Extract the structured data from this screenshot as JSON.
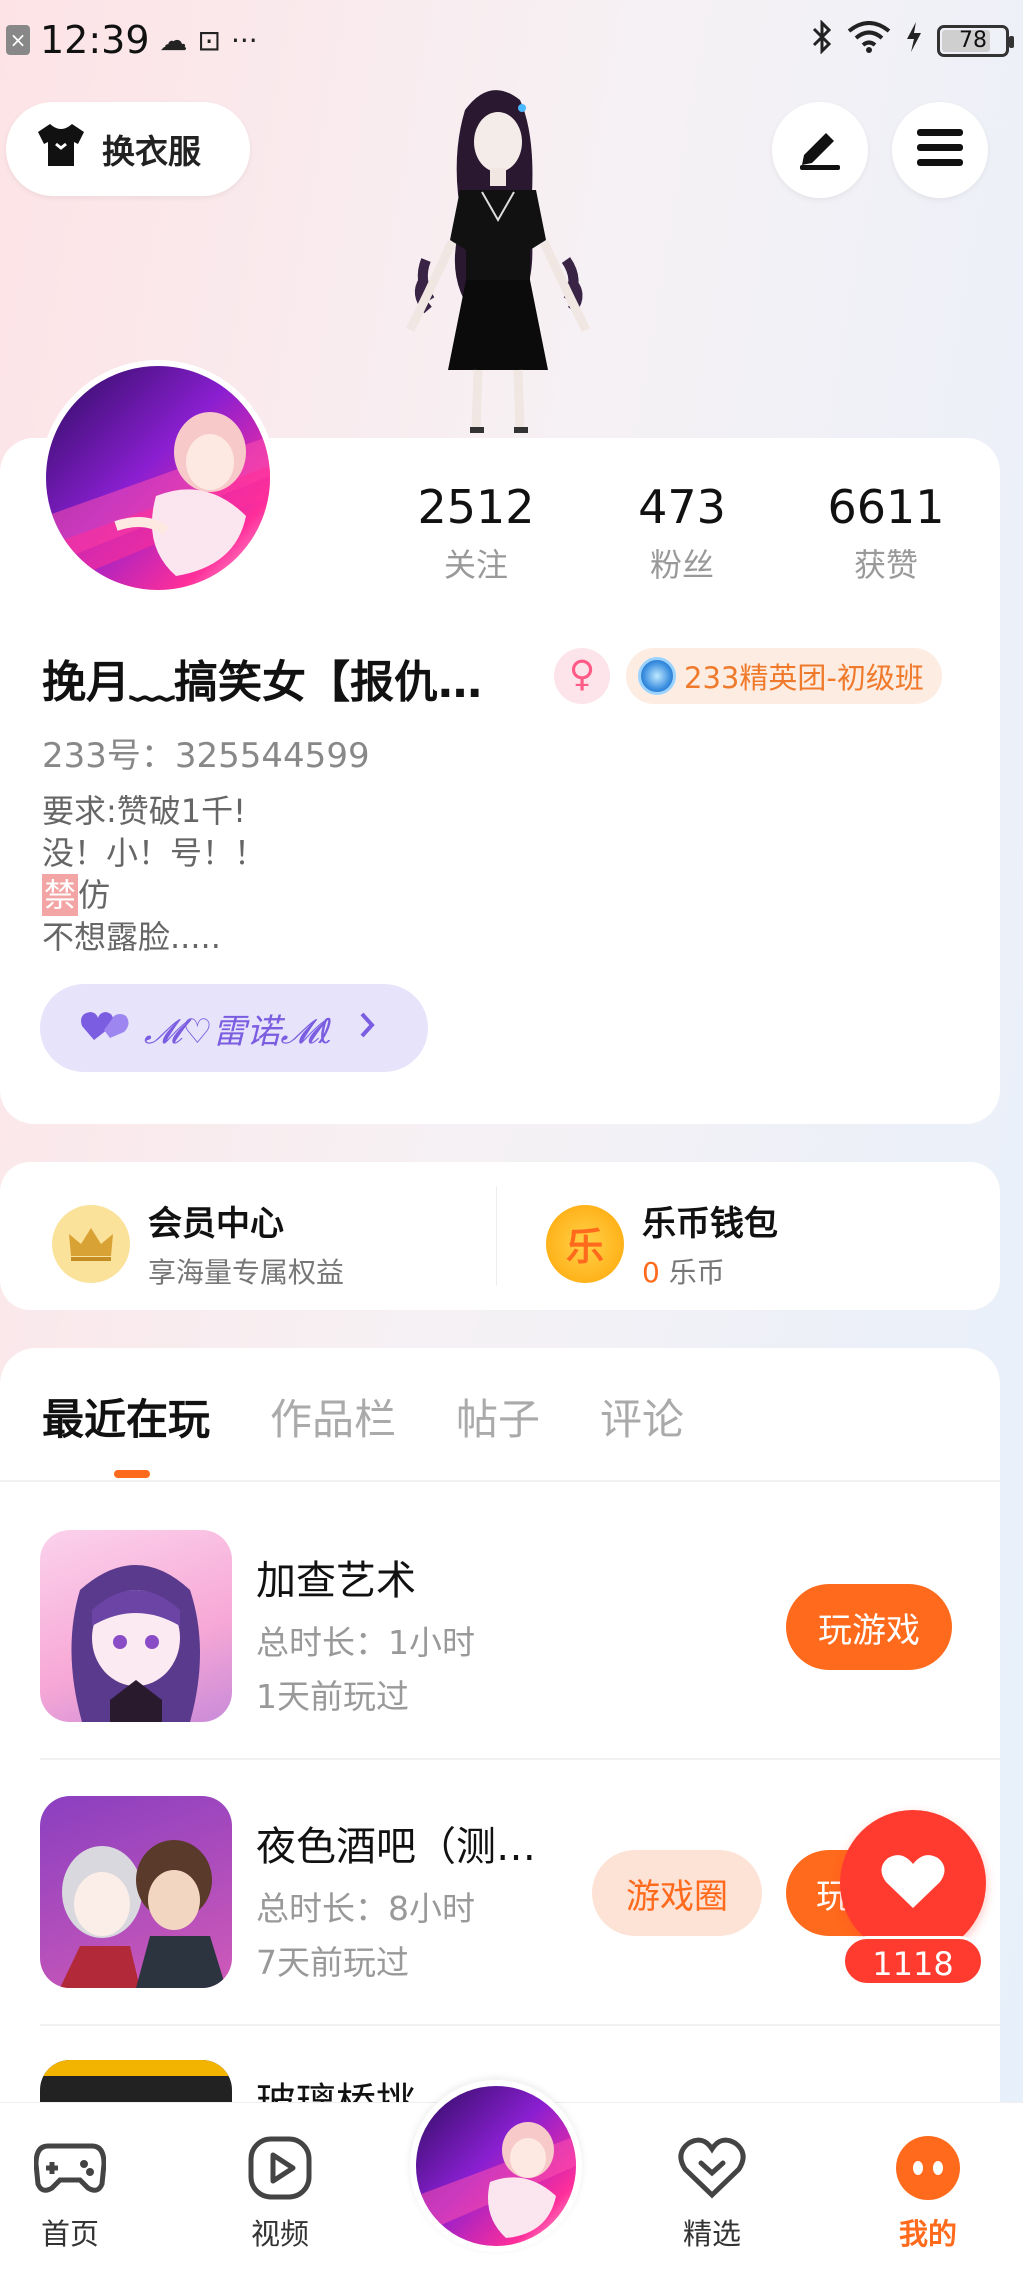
{
  "status_bar": {
    "time": "12:39",
    "battery": "78",
    "battery_level": 0.78,
    "more": "···"
  },
  "top": {
    "outfit_label": "换衣服"
  },
  "profile": {
    "stats": [
      {
        "value": "2512",
        "label": "关注"
      },
      {
        "value": "473",
        "label": "粉丝"
      },
      {
        "value": "6611",
        "label": "获赞"
      }
    ],
    "nickname": "挽月﹏搞笑女【报仇…",
    "gender_symbol": "♀",
    "rank": "233精英团-初级班",
    "uid": "233号：325544599",
    "bio": {
      "line1": "要求:赞破1千!",
      "line2": "没！小！号！！",
      "line3_tag": "禁",
      "line3_rest": "仿",
      "line4": "不想露脸....."
    },
    "friend": "𝓜♡雷诺𝓜ℓ"
  },
  "member": {
    "vip_title": "会员中心",
    "vip_sub": "享海量专属权益",
    "wallet_title": "乐币钱包",
    "wallet_amount": "0",
    "wallet_unit": "乐币",
    "coin_char": "乐"
  },
  "tabs": [
    "最近在玩",
    "作品栏",
    "帖子",
    "评论"
  ],
  "games": [
    {
      "name": "加查艺术",
      "duration": "总时长：1小时",
      "last_played": "1天前玩过",
      "play_label": "玩游戏"
    },
    {
      "name": "夜色酒吧（测…",
      "duration": "总时长：8小时",
      "last_played": "7天前玩过",
      "circle_label": "游戏圈",
      "play_label": "玩游戏"
    },
    {
      "name": "玻璃桥挑"
    }
  ],
  "floating_like": {
    "count": "1118"
  },
  "bottom_nav": [
    {
      "label": "首页"
    },
    {
      "label": "视频"
    },
    {
      "label": "精选"
    },
    {
      "label": "我的"
    }
  ],
  "colors": {
    "accent": "#ff6a1c",
    "like": "#ff3b30",
    "friend_pill": "#e6e3fb"
  }
}
